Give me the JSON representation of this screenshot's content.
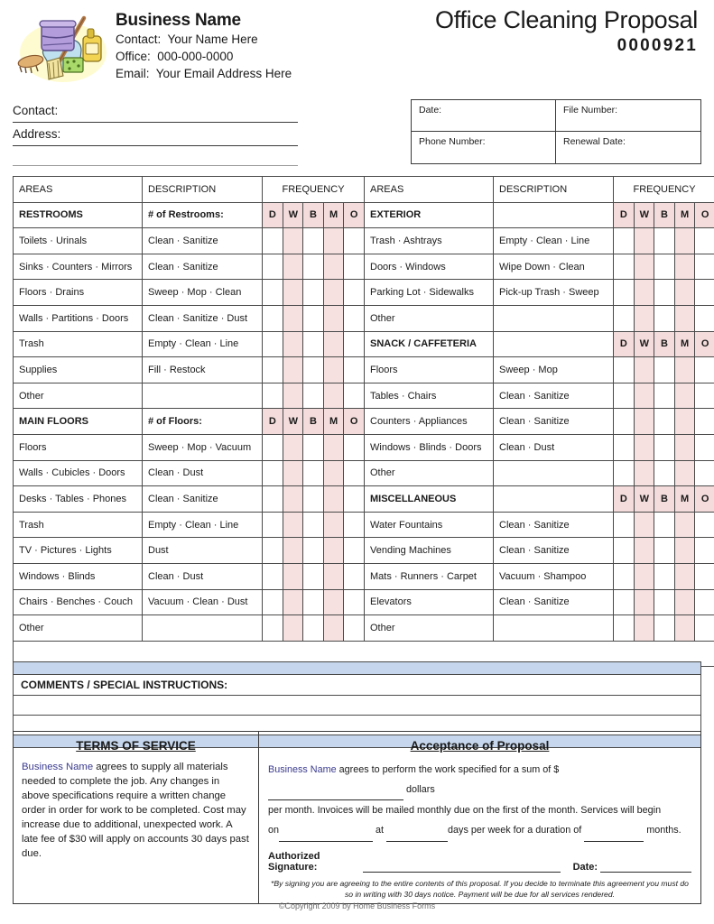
{
  "header": {
    "business_name": "Business Name",
    "contact_line": "Contact:  Your Name Here",
    "office_line": "Office:  000-000-0000",
    "email_line": "Email:  Your Email Address Here",
    "doc_title": "Office Cleaning Proposal",
    "doc_number": "0000921",
    "logo_icon": "cleaning-supplies-icon"
  },
  "contact_fields": {
    "contact_label": "Contact:",
    "address_label": "Address:"
  },
  "meta": {
    "date_label": "Date:",
    "file_number_label": "File Number:",
    "phone_label": "Phone Number:",
    "renewal_label": "Renewal Date:"
  },
  "table": {
    "col_headers": [
      "AREAS",
      "DESCRIPTION",
      "FREQUENCY"
    ],
    "freq_codes": [
      "D",
      "W",
      "B",
      "M",
      "O"
    ],
    "freq_shading": [
      "white",
      "pink",
      "white",
      "pink",
      "white"
    ],
    "left_sections": [
      {
        "name": "RESTROOMS",
        "desc": "# of Restrooms:",
        "rows": [
          {
            "area": "Toilets · Urinals",
            "desc": "Clean · Sanitize"
          },
          {
            "area": "Sinks · Counters · Mirrors",
            "desc": "Clean · Sanitize"
          },
          {
            "area": "Floors · Drains",
            "desc": "Sweep · Mop · Clean"
          },
          {
            "area": "Walls · Partitions · Doors",
            "desc": "Clean · Sanitize · Dust"
          },
          {
            "area": "Trash",
            "desc": "Empty · Clean · Line"
          },
          {
            "area": "Supplies",
            "desc": "Fill · Restock"
          },
          {
            "area": "Other",
            "desc": ""
          }
        ]
      },
      {
        "name": "MAIN FLOORS",
        "desc": "# of Floors:",
        "rows": [
          {
            "area": "Floors",
            "desc": "Sweep · Mop · Vacuum"
          },
          {
            "area": "Walls · Cubicles · Doors",
            "desc": "Clean · Dust"
          },
          {
            "area": "Desks · Tables · Phones",
            "desc": "Clean · Sanitize"
          },
          {
            "area": "Trash",
            "desc": "Empty · Clean · Line"
          },
          {
            "area": "TV · Pictures · Lights",
            "desc": "Dust"
          },
          {
            "area": "Windows · Blinds",
            "desc": "Clean · Dust"
          },
          {
            "area": "Chairs · Benches · Couch",
            "desc": "Vacuum · Clean · Dust"
          },
          {
            "area": "Other",
            "desc": ""
          }
        ]
      }
    ],
    "right_sections": [
      {
        "name": "EXTERIOR",
        "desc": "",
        "rows": [
          {
            "area": "Trash · Ashtrays",
            "desc": "Empty · Clean · Line"
          },
          {
            "area": "Doors · Windows",
            "desc": "Wipe Down · Clean"
          },
          {
            "area": "Parking Lot · Sidewalks",
            "desc": "Pick-up Trash · Sweep"
          },
          {
            "area": "Other",
            "desc": ""
          }
        ]
      },
      {
        "name": "SNACK / CAFFETERIA",
        "desc": "",
        "rows": [
          {
            "area": "Floors",
            "desc": "Sweep · Mop"
          },
          {
            "area": "Tables · Chairs",
            "desc": "Clean · Sanitize"
          },
          {
            "area": "Counters · Appliances",
            "desc": "Clean · Sanitize"
          },
          {
            "area": "Windows · Blinds · Doors",
            "desc": "Clean · Dust"
          },
          {
            "area": "Other",
            "desc": ""
          }
        ]
      },
      {
        "name": "MISCELLANEOUS",
        "desc": "",
        "rows": [
          {
            "area": "Water Fountains",
            "desc": "Clean · Sanitize"
          },
          {
            "area": "Vending Machines",
            "desc": "Clean · Sanitize"
          },
          {
            "area": "Mats · Runners · Carpet",
            "desc": "Vacuum · Shampoo"
          },
          {
            "area": "Elevators",
            "desc": "Clean · Sanitize"
          },
          {
            "area": "Other",
            "desc": ""
          }
        ]
      }
    ]
  },
  "comments": {
    "title": "COMMENTS / SPECIAL INSTRUCTIONS:"
  },
  "terms": {
    "heading": "TERMS OF SERVICE",
    "business_name": "Business Name",
    "body": " agrees to supply all materials needed to complete the job.  Any changes in above specifications require a written change order in order for work to be completed.  Cost may increase due to additional, unexpected work.  A late fee of $30 will apply on accounts 30 days past due."
  },
  "acceptance": {
    "heading": "Acceptance of Proposal",
    "business_name": "Business Name",
    "p1_a": " agrees to perform the work specified for a sum of $",
    "p1_b": "dollars",
    "p2": "per month.  Invoices will be mailed monthly due on the first of the month.  Services will begin",
    "p3_a": "on",
    "p3_b": "at",
    "p3_c": "days per week for a duration of",
    "p3_d": "months.",
    "signature_label": "Authorized Signature:",
    "date_label": "Date:",
    "fineprint": "*By signing you are agreeing to the entire contents of this proposal.  If you decide to terminate this agreement you must do so in writing with 30 days notice.  Payment will be due for all services rendered."
  },
  "footer": {
    "copyright": "©Copyright 2009 by Home Business Forms"
  },
  "colors": {
    "header_blue": "#c6d6ec",
    "section_pink": "#f4dcdc",
    "freq_pink": "#f6e0e0",
    "business_name_blue": "#3b3b8f"
  }
}
